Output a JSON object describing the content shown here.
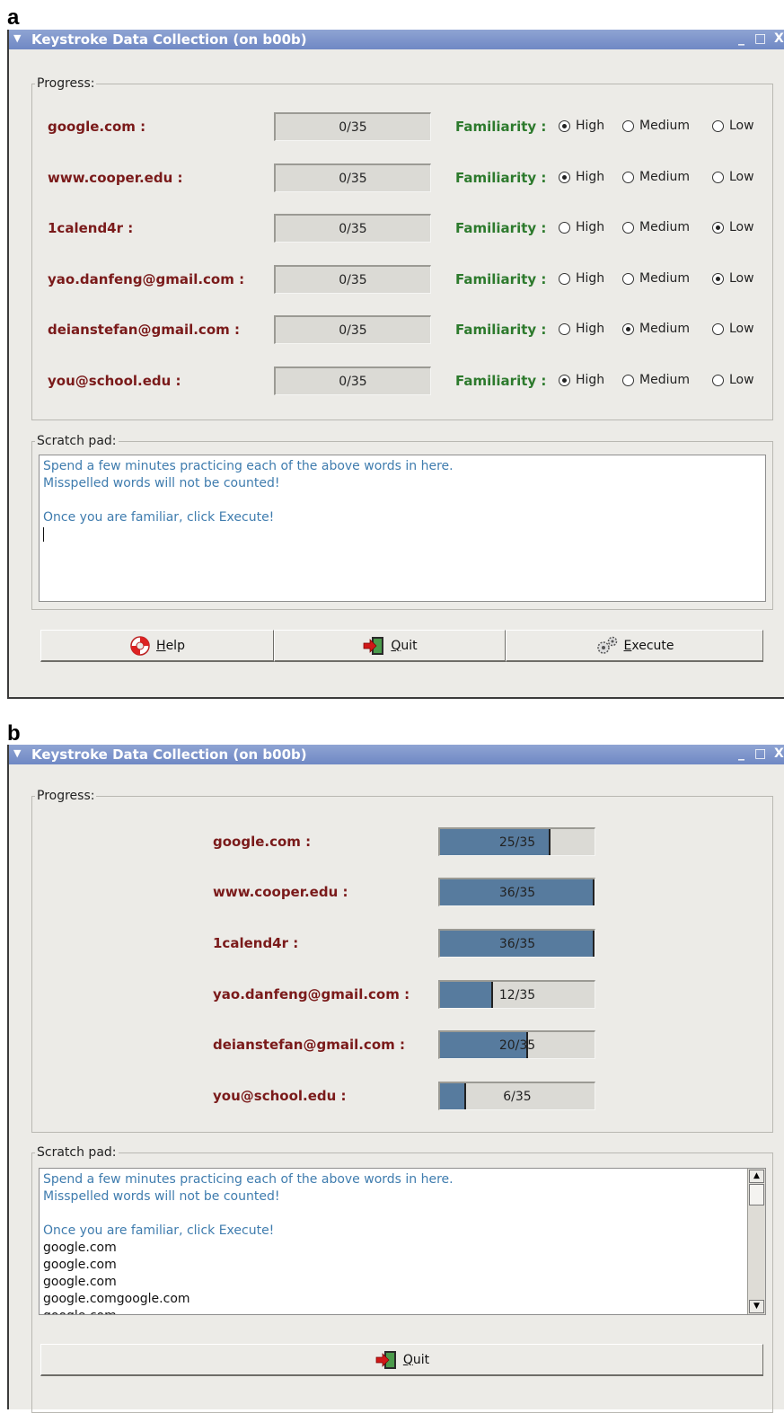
{
  "panel_a": {
    "letter": "a",
    "title": "Keystroke Data Collection (on b00b)",
    "window_controls": [
      "_",
      "□",
      "X"
    ],
    "progress_label": "Progress:",
    "familiarity_label": "Familiarity :",
    "options": [
      "High",
      "Medium",
      "Low"
    ],
    "rows": [
      {
        "word": "google.com :",
        "progress": "0/35",
        "selected": "High"
      },
      {
        "word": "www.cooper.edu :",
        "progress": "0/35",
        "selected": "High"
      },
      {
        "word": "1calend4r :",
        "progress": "0/35",
        "selected": "Low"
      },
      {
        "word": "yao.danfeng@gmail.com :",
        "progress": "0/35",
        "selected": "Low"
      },
      {
        "word": "deianstefan@gmail.com :",
        "progress": "0/35",
        "selected": "Medium"
      },
      {
        "word": "you@school.edu :",
        "progress": "0/35",
        "selected": "High"
      }
    ],
    "scratch_label": "Scratch pad:",
    "scratch_lines": [
      "Spend a few minutes practicing each of the above words in here.",
      "Misspelled words will not be counted!",
      "",
      "Once you are familiar, click Execute!"
    ],
    "buttons": {
      "help": {
        "mnemonic": "H",
        "rest": "elp"
      },
      "quit": {
        "mnemonic": "Q",
        "rest": "uit"
      },
      "execute": {
        "mnemonic": "E",
        "rest": "xecute"
      }
    }
  },
  "panel_b": {
    "letter": "b",
    "title": "Keystroke Data Collection (on b00b)",
    "window_controls": [
      "_",
      "□",
      "X"
    ],
    "progress_label": "Progress:",
    "rows": [
      {
        "word": "google.com :",
        "progress": "25/35",
        "fraction": 0.714
      },
      {
        "word": "www.cooper.edu :",
        "progress": "36/35",
        "fraction": 1.0
      },
      {
        "word": "1calend4r :",
        "progress": "36/35",
        "fraction": 1.0
      },
      {
        "word": "yao.danfeng@gmail.com :",
        "progress": "12/35",
        "fraction": 0.343
      },
      {
        "word": "deianstefan@gmail.com :",
        "progress": "20/35",
        "fraction": 0.571
      },
      {
        "word": "you@school.edu :",
        "progress": "6/35",
        "fraction": 0.171
      }
    ],
    "scratch_label": "Scratch pad:",
    "scratch_hint_lines": [
      "Spend a few minutes practicing each of the above words in here.",
      "Misspelled words will not be counted!",
      "",
      "Once you are familiar, click Execute!"
    ],
    "scratch_typed_lines": [
      "google.com",
      "google.com",
      "google.com",
      "google.comgoogle.com",
      "google.com"
    ],
    "buttons": {
      "quit": {
        "mnemonic": "Q",
        "rest": "uit"
      }
    }
  }
}
